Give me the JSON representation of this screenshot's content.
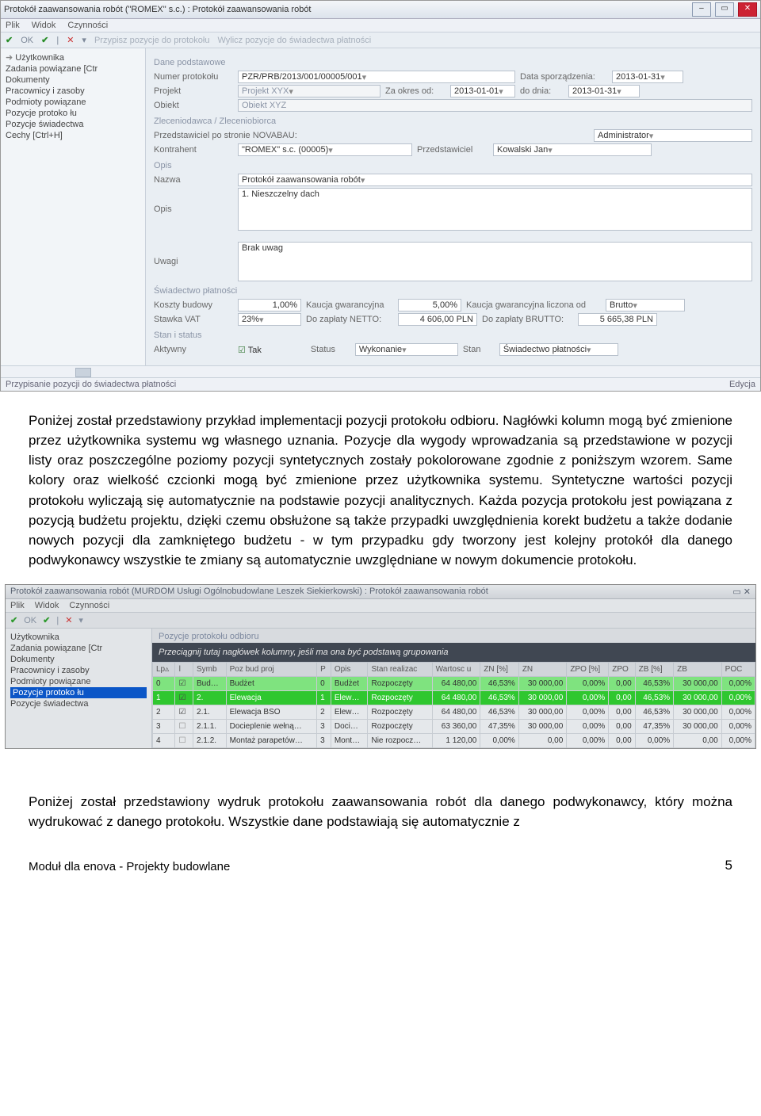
{
  "shot1": {
    "title": "Protokół zaawansowania robót (\"ROMEX\" s.c.) : Protokół zaawansowania robót",
    "menu": [
      "Plik",
      "Widok",
      "Czynności"
    ],
    "toolbar": {
      "ok": "OK",
      "assign": "Przypisz pozycje do protokołu",
      "calc": "Wylicz pozycje do świadectwa płatności"
    },
    "side": [
      "Użytkownika",
      "Zadania powiązane [Ctr",
      "Dokumenty",
      "Pracownicy i zasoby",
      "Podmioty powiązane",
      "Pozycje protoko łu",
      "Pozycje świadectwa",
      "Cechy [Ctrl+H]"
    ],
    "groups": {
      "dane": "Dane podstawowe",
      "zlec": "Zleceniodawca / Zleceniobiorca",
      "opis": "Opis",
      "swiad": "Świadectwo płatności",
      "stan": "Stan i status"
    },
    "labels": {
      "numer": "Numer protokołu",
      "data_sporz": "Data sporządzenia:",
      "projekt": "Projekt",
      "za_okres": "Za okres od:",
      "do_dnia": "do dnia:",
      "obiekt": "Obiekt",
      "przed_nova": "Przedstawiciel po stronie NOVABAU:",
      "kontrahent": "Kontrahent",
      "przedstawiciel": "Przedstawiciel",
      "nazwa": "Nazwa",
      "opis": "Opis",
      "uwagi": "Uwagi",
      "koszty": "Koszty budowy",
      "kaucja": "Kaucja gwarancyjna",
      "kaucja_od": "Kaucja gwarancyjna liczona od",
      "stawka": "Stawka VAT",
      "netto": "Do zapłaty NETTO:",
      "brutto": "Do zapłaty BRUTTO:",
      "aktywny": "Aktywny",
      "tak": "Tak",
      "status": "Status",
      "stan": "Stan"
    },
    "values": {
      "numer": "PZR/PRB/2013/001/00005/001",
      "data_sporz": "2013-01-31",
      "projekt": "Projekt XYX",
      "za_okres": "2013-01-01",
      "do_dnia": "2013-01-31",
      "obiekt": "Obiekt XYZ",
      "admin": "Administrator",
      "kontrahent": "\"ROMEX\" s.c. (00005)",
      "przedstawiciel": "Kowalski Jan",
      "nazwa": "Protokół zaawansowania robót",
      "opis": "1. Nieszczelny dach",
      "uwagi": "Brak uwag",
      "koszty": "1,00%",
      "kaucja": "5,00%",
      "kaucja_od": "Brutto",
      "stawka": "23%",
      "netto": "4 606,00 PLN",
      "brutto": "5 665,38 PLN",
      "status": "Wykonanie",
      "stan": "Świadectwo płatności"
    },
    "status_left": "Przypisanie pozycji do świadectwa płatności",
    "status_right": "Edycja"
  },
  "para1": "Poniżej został przedstawiony przykład implementacji pozycji protokołu odbioru. Nagłówki kolumn mogą być zmienione przez użytkownika systemu wg własnego uznania. Pozycje dla wygody wprowadzania są przedstawione w pozycji listy oraz poszczególne poziomy pozycji syntetycznych zostały pokolorowane zgodnie z poniższym wzorem. Same kolory oraz wielkość czcionki mogą być zmienione przez użytkownika systemu. Syntetyczne wartości pozycji protokołu wyliczają się automatycznie na podstawie pozycji analitycznych. Każda pozycja protokołu jest powiązana z pozycją budżetu projektu, dzięki czemu obsłużone są także przypadki uwzględnienia korekt budżetu a także dodanie nowych pozycji dla zamkniętego budżetu - w tym przypadku gdy tworzony jest kolejny protokół dla danego podwykonawcy wszystkie te zmiany są automatycznie uwzględniane w nowym dokumencie protokołu.",
  "shot2": {
    "title": "Protokół zaawansowania robót (MURDOM Usługi Ogólnobudowlane Leszek Siekierkowski) : Protokół zaawansowania robót",
    "menu": [
      "Plik",
      "Widok",
      "Czynności"
    ],
    "ok": "OK",
    "side": [
      "Użytkownika",
      "Zadania powiązane [Ctr",
      "Dokumenty",
      "Pracownicy i zasoby",
      "Podmioty powiązane",
      "Pozycje protoko łu",
      "Pozycje świadectwa"
    ],
    "side_sel": 5,
    "caption": "Pozycje protokołu odbioru",
    "group_header": "Przeciągnij tutaj nagłówek kolumny, jeśli ma ona być podstawą grupowania",
    "cols": [
      "Lp▵",
      "ǀ",
      "Symb",
      "Poz bud proj",
      "P",
      "Opis",
      "Stan realizac",
      "Wartosc u",
      "ZN [%]",
      "ZN",
      "ZPO [%]",
      "ZPO",
      "ZB [%]",
      "ZB",
      "POC"
    ],
    "rows": [
      {
        "lvl": 0,
        "lp": "0",
        "chk": true,
        "symb": "Bud…",
        "poz": "Budżet",
        "p": "0",
        "opis": "Budżet",
        "stan": "Rozpoczęty",
        "wart": "64 480,00",
        "znp": "46,53%",
        "zn": "30 000,00",
        "zpop": "0,00%",
        "zpo": "0,00",
        "zbp": "46,53%",
        "zb": "30 000,00",
        "poc": "0,00%"
      },
      {
        "lvl": 1,
        "lp": "1",
        "chk": true,
        "symb": "2.",
        "poz": "Elewacja",
        "p": "1",
        "opis": "Elew…",
        "stan": "Rozpoczęty",
        "wart": "64 480,00",
        "znp": "46,53%",
        "zn": "30 000,00",
        "zpop": "0,00%",
        "zpo": "0,00",
        "zbp": "46,53%",
        "zb": "30 000,00",
        "poc": "0,00%"
      },
      {
        "lvl": 2,
        "lp": "2",
        "chk": true,
        "symb": "2.1.",
        "poz": "Elewacja BSO",
        "p": "2",
        "opis": "Elew…",
        "stan": "Rozpoczęty",
        "wart": "64 480,00",
        "znp": "46,53%",
        "zn": "30 000,00",
        "zpop": "0,00%",
        "zpo": "0,00",
        "zbp": "46,53%",
        "zb": "30 000,00",
        "poc": "0,00%"
      },
      {
        "lvl": 2,
        "lp": "3",
        "chk": false,
        "symb": "2.1.1.",
        "poz": "Docieplenie wełną…",
        "p": "3",
        "opis": "Doci…",
        "stan": "Rozpoczęty",
        "wart": "63 360,00",
        "znp": "47,35%",
        "zn": "30 000,00",
        "zpop": "0,00%",
        "zpo": "0,00",
        "zbp": "47,35%",
        "zb": "30 000,00",
        "poc": "0,00%"
      },
      {
        "lvl": 2,
        "lp": "4",
        "chk": false,
        "symb": "2.1.2.",
        "poz": "Montaż parapetów…",
        "p": "3",
        "opis": "Mont…",
        "stan": "Nie rozpocz…",
        "wart": "1 120,00",
        "znp": "0,00%",
        "zn": "0,00",
        "zpop": "0,00%",
        "zpo": "0,00",
        "zbp": "0,00%",
        "zb": "0,00",
        "poc": "0,00%"
      }
    ]
  },
  "para2": "Poniżej został przedstawiony wydruk protokołu zaawansowania robót dla danego podwykonawcy, który można wydrukować z danego protokołu. Wszystkie dane podstawiają się automatycznie z",
  "footer": {
    "left": "Moduł dla enova - Projekty budowlane",
    "page": "5"
  }
}
